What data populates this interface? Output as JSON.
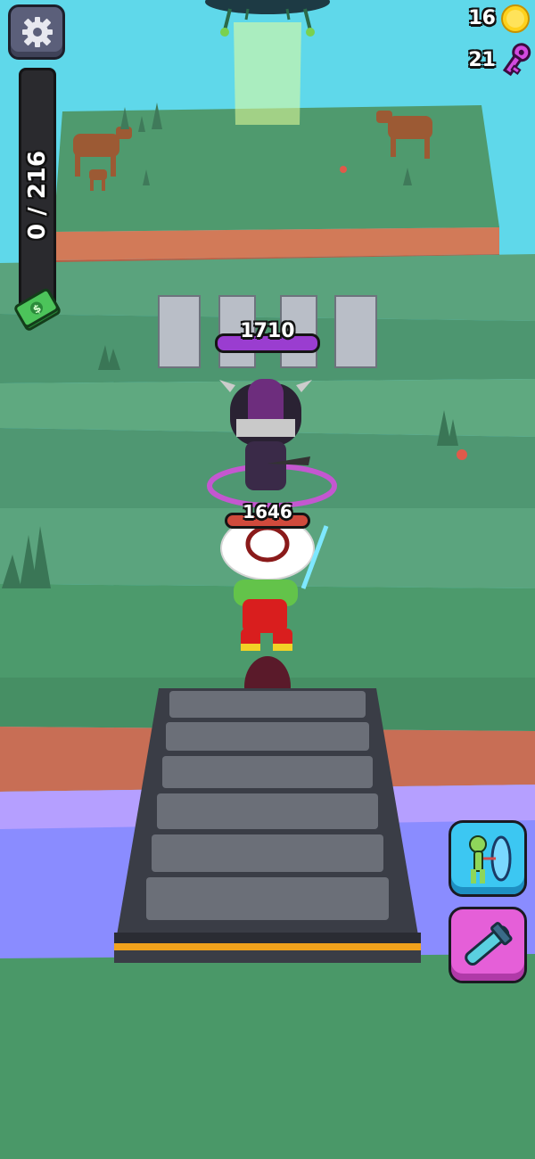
{
  "hud": {
    "progress": {
      "current": 0,
      "total": 216,
      "label": "0 / 216"
    },
    "coins": "16",
    "keys": "21"
  },
  "boss": {
    "health": "1710"
  },
  "player": {
    "health": "1646"
  },
  "abilities": [
    "portal-ability",
    "weapon-ability"
  ],
  "colors": {
    "sky": "#5fd8ea",
    "grass": "#4c9a6c",
    "boss_bar": "#9a3dd0",
    "player_bar": "#d04a3c",
    "coin": "#ffd21d",
    "key": "#d24ae0"
  }
}
